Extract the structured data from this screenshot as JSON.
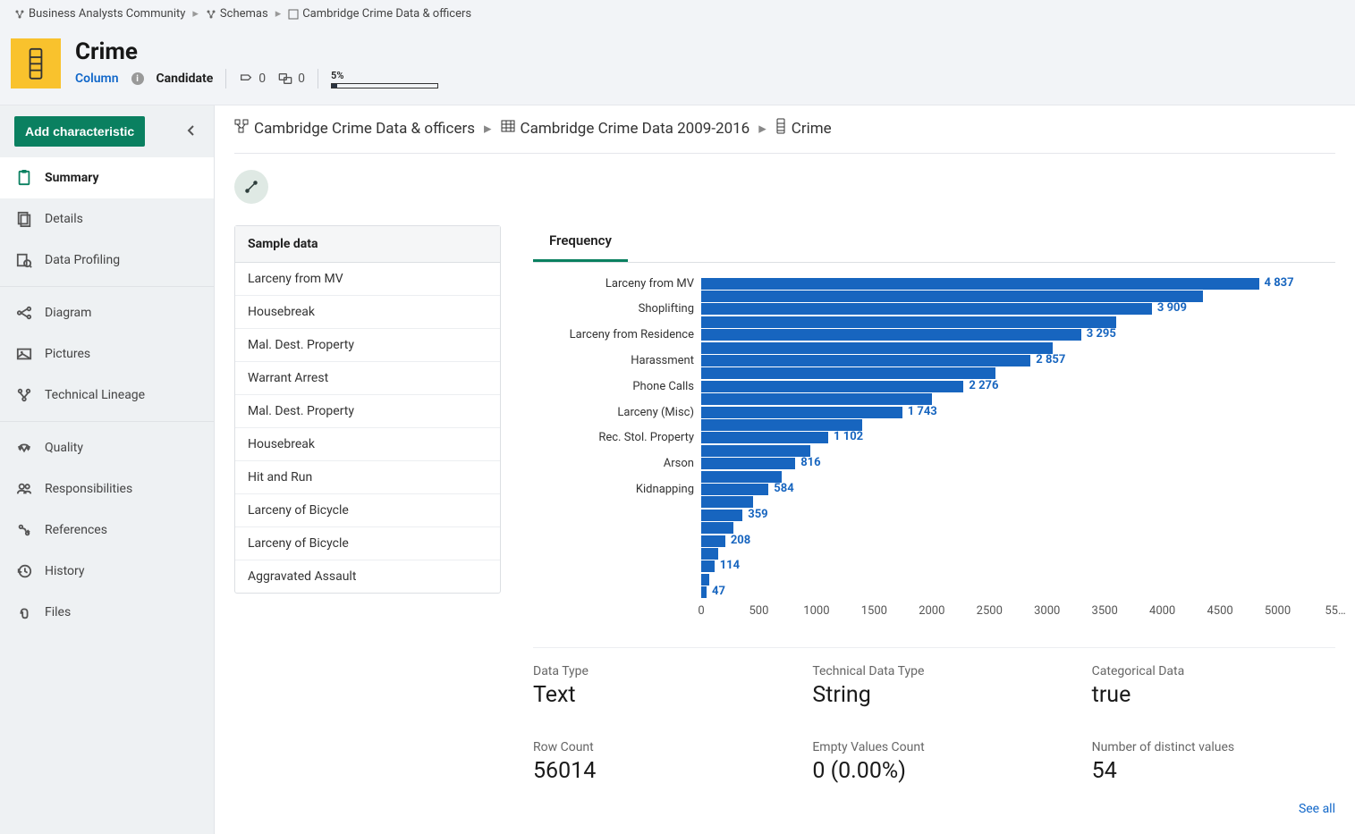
{
  "breadcrumb_top": {
    "items": [
      {
        "label": "Business Analysts Community",
        "icon": "org"
      },
      {
        "label": "Schemas",
        "icon": "org"
      },
      {
        "label": "Cambridge Crime Data & officers",
        "icon": "schema"
      }
    ]
  },
  "header": {
    "title": "Crime",
    "type_label": "Column",
    "status": "Candidate",
    "reply_count": "0",
    "comment_count": "0",
    "progress_label": "5%",
    "progress_pct": 5
  },
  "sidebar": {
    "add_label": "Add characteristic",
    "groups": [
      {
        "items": [
          {
            "id": "summary",
            "label": "Summary",
            "active": true
          },
          {
            "id": "details",
            "label": "Details"
          },
          {
            "id": "profiling",
            "label": "Data Profiling"
          }
        ]
      },
      {
        "items": [
          {
            "id": "diagram",
            "label": "Diagram"
          },
          {
            "id": "pictures",
            "label": "Pictures"
          },
          {
            "id": "lineage",
            "label": "Technical Lineage"
          }
        ]
      },
      {
        "items": [
          {
            "id": "quality",
            "label": "Quality"
          },
          {
            "id": "resp",
            "label": "Responsibilities"
          },
          {
            "id": "refs",
            "label": "References"
          },
          {
            "id": "history",
            "label": "History"
          },
          {
            "id": "files",
            "label": "Files"
          }
        ]
      }
    ]
  },
  "inner_breadcrumb": {
    "items": [
      {
        "label": "Cambridge Crime Data & officers",
        "icon": "schema"
      },
      {
        "label": "Cambridge Crime Data 2009-2016",
        "icon": "table"
      },
      {
        "label": "Crime",
        "icon": "column"
      }
    ]
  },
  "sample_data": {
    "heading": "Sample data",
    "rows": [
      "Larceny from MV",
      "Housebreak",
      "Mal. Dest. Property",
      "Warrant Arrest",
      "Mal. Dest. Property",
      "Housebreak",
      "Hit and Run",
      "Larceny of Bicycle",
      "Larceny of Bicycle",
      "Aggravated Assault"
    ]
  },
  "chart_tab": "Frequency",
  "chart_data": {
    "type": "bar",
    "orientation": "horizontal",
    "title": "Frequency",
    "xlabel": "",
    "ylabel": "",
    "xlim": [
      0,
      5500
    ],
    "xticks": [
      0,
      500,
      1000,
      1500,
      2000,
      2500,
      3000,
      3500,
      4000,
      4500,
      5000,
      5500
    ],
    "xtick_labels": [
      "0",
      "500",
      "1000",
      "1500",
      "2000",
      "2500",
      "3000",
      "3500",
      "4000",
      "4500",
      "5000",
      "55…"
    ],
    "visible_labeled": [
      {
        "category": "Larceny from MV",
        "value": 4837,
        "display": "4 837"
      },
      {
        "category": "Shoplifting",
        "value": 3909,
        "display": "3 909"
      },
      {
        "category": "Larceny from Residence",
        "value": 3295,
        "display": "3 295"
      },
      {
        "category": "Harassment",
        "value": 2857,
        "display": "2 857"
      },
      {
        "category": "Phone Calls",
        "value": 2276,
        "display": "2 276"
      },
      {
        "category": "Larceny (Misc)",
        "value": 1743,
        "display": "1 743"
      },
      {
        "category": "Rec. Stol. Property",
        "value": 1102,
        "display": "1 102"
      },
      {
        "category": "Arson",
        "value": 816,
        "display": "816"
      },
      {
        "category": "Kidnapping",
        "value": 584,
        "display": "584"
      }
    ],
    "additional_displayed_values": [
      359,
      208,
      114,
      47
    ],
    "bars_rendered": [
      4837,
      4350,
      3909,
      3600,
      3295,
      3050,
      2857,
      2550,
      2276,
      2000,
      1743,
      1400,
      1102,
      950,
      816,
      700,
      584,
      450,
      359,
      280,
      208,
      150,
      114,
      70,
      47
    ]
  },
  "stats": [
    {
      "label": "Data Type",
      "value": "Text"
    },
    {
      "label": "Technical Data Type",
      "value": "String"
    },
    {
      "label": "Categorical Data",
      "value": "true"
    },
    {
      "label": "Row Count",
      "value": "56014"
    },
    {
      "label": "Empty Values Count",
      "value": "0 (0.00%)"
    },
    {
      "label": "Number of distinct values",
      "value": "54"
    }
  ],
  "see_all_label": "See all"
}
